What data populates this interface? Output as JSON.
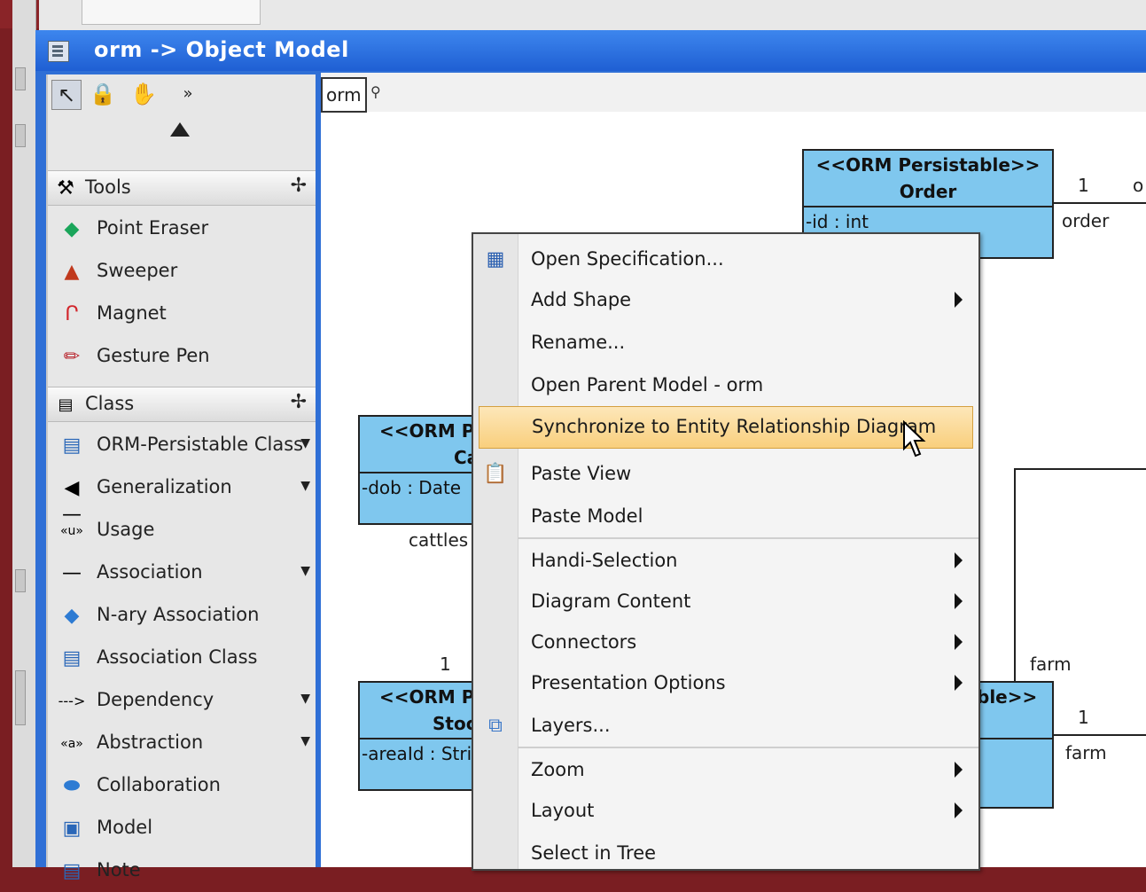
{
  "window": {
    "title": "orm -> Object Model"
  },
  "palette": {
    "tools_group": "Tools",
    "tools": [
      {
        "label": "Point Eraser",
        "icon": "eraser-icon"
      },
      {
        "label": "Sweeper",
        "icon": "sweeper-icon"
      },
      {
        "label": "Magnet",
        "icon": "magnet-icon"
      },
      {
        "label": "Gesture Pen",
        "icon": "pen-icon"
      }
    ],
    "class_group": "Class",
    "items": [
      {
        "label": "ORM-Persistable Class",
        "icon": "orm-class-icon",
        "has_menu": true
      },
      {
        "label": "Generalization",
        "icon": "generalization-icon",
        "has_menu": true
      },
      {
        "label": "Usage",
        "icon": "usage-icon",
        "has_menu": false
      },
      {
        "label": "Association",
        "icon": "association-icon",
        "has_menu": true
      },
      {
        "label": "N-ary Association",
        "icon": "nary-association-icon",
        "has_menu": false
      },
      {
        "label": "Association Class",
        "icon": "association-class-icon",
        "has_menu": false
      },
      {
        "label": "Dependency",
        "icon": "dependency-icon",
        "has_menu": true
      },
      {
        "label": "Abstraction",
        "icon": "abstraction-icon",
        "has_menu": true
      },
      {
        "label": "Collaboration",
        "icon": "collaboration-icon",
        "has_menu": false
      },
      {
        "label": "Model",
        "icon": "model-icon",
        "has_menu": false
      },
      {
        "label": "Note",
        "icon": "note-icon",
        "has_menu": false
      }
    ]
  },
  "canvas": {
    "breadcrumb": "orm",
    "classes": {
      "order": {
        "stereotype": "<<ORM Persistable>>",
        "name": "Order",
        "attr": "-id : int"
      },
      "cattle": {
        "stereotype": "<<ORM Pe",
        "name": "Ca",
        "attr": "-dob : Date"
      },
      "stock": {
        "stereotype": "<<ORM Pe",
        "name": "Stoc",
        "attr": "-areaId : Stri"
      },
      "farm": {
        "stereotype": "ble>>"
      }
    },
    "labels": {
      "order_mult": "1",
      "order_o": "o",
      "order_role": "order",
      "cattles": "cattles",
      "stock_mult": "1",
      "farm_role_top": "farm",
      "farm_mult": "1",
      "farm_role": "farm",
      "bracket": ")"
    }
  },
  "context_menu": {
    "items": [
      {
        "label": "Open Specification...",
        "icon": "specification-icon"
      },
      {
        "label": "Add Shape",
        "submenu": true
      },
      {
        "label": "Rename..."
      },
      {
        "label": "Open Parent Model - orm"
      },
      {
        "label": "Synchronize to Entity Relationship Diagram",
        "highlighted": true
      },
      {
        "label": "Paste View",
        "icon": "paste-icon"
      },
      {
        "label": "Paste Model"
      },
      {
        "label": "Handi-Selection",
        "submenu": true
      },
      {
        "label": "Diagram Content",
        "submenu": true
      },
      {
        "label": "Connectors",
        "submenu": true
      },
      {
        "label": "Presentation Options",
        "submenu": true
      },
      {
        "label": "Layers...",
        "icon": "layers-icon"
      },
      {
        "label": "Zoom",
        "submenu": true
      },
      {
        "label": "Layout",
        "submenu": true
      },
      {
        "label": "Select in Tree"
      }
    ]
  },
  "colors": {
    "title_bar": "#2f6fd6",
    "class_fill": "#7fc7ee",
    "highlight": "#f9cf7d"
  }
}
